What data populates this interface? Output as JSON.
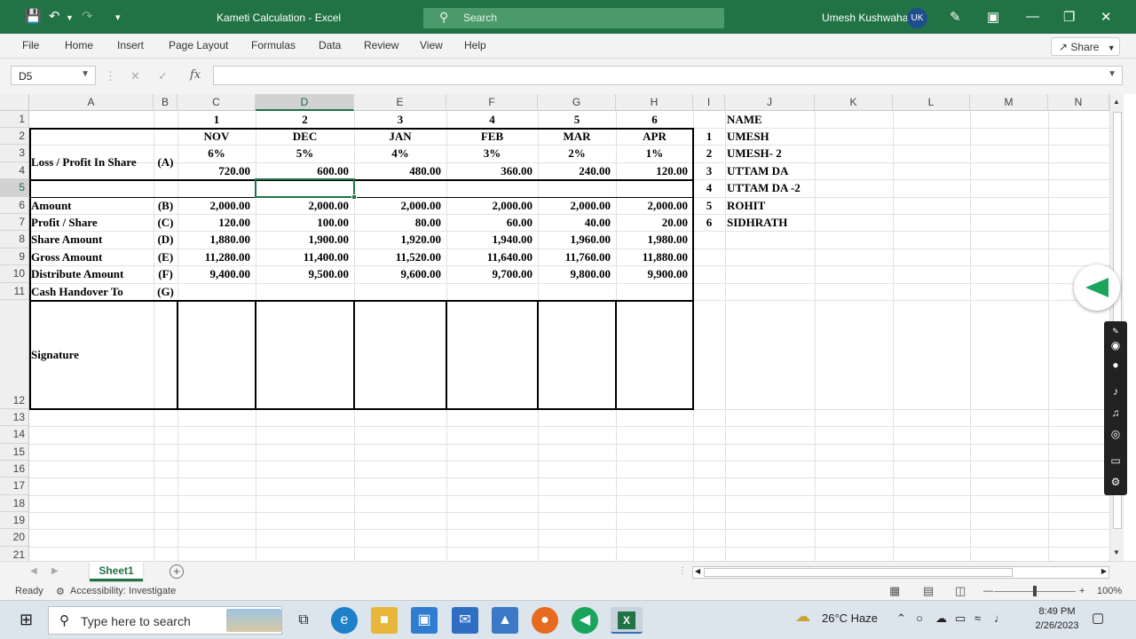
{
  "titlebar": {
    "title": "Kameti Calculation  -  Excel",
    "search_placeholder": "Search",
    "user_name": "Umesh Kushwaha",
    "user_initials": "UK"
  },
  "ribbon": {
    "tabs": [
      "File",
      "Home",
      "Insert",
      "Page Layout",
      "Formulas",
      "Data",
      "Review",
      "View",
      "Help"
    ],
    "share_label": "Share"
  },
  "formula_bar": {
    "name_box": "D5",
    "fx_label": "fx",
    "formula": ""
  },
  "columns": [
    "A",
    "B",
    "C",
    "D",
    "E",
    "F",
    "G",
    "H",
    "I",
    "J",
    "K",
    "L",
    "M",
    "N"
  ],
  "rows": [
    "1",
    "2",
    "3",
    "4",
    "5",
    "6",
    "7",
    "8",
    "9",
    "10",
    "11",
    "12",
    "13",
    "14",
    "15",
    "16",
    "17",
    "18",
    "19",
    "20",
    "21"
  ],
  "selected_cell": {
    "column": "D",
    "row": "5"
  },
  "sheet": {
    "serials": [
      "1",
      "2",
      "3",
      "4",
      "5",
      "6"
    ],
    "months": [
      "NOV",
      "DEC",
      "JAN",
      "FEB",
      "MAR",
      "APR"
    ],
    "percentages": [
      "6%",
      "5%",
      "4%",
      "3%",
      "2%",
      "1%"
    ],
    "loss_profit_label": "Loss / Profit In Share",
    "loss_profit_code": "(A)",
    "loss_profit_values": [
      "720.00",
      "600.00",
      "480.00",
      "360.00",
      "240.00",
      "120.00"
    ],
    "rows": [
      {
        "label": "Amount",
        "code": "(B)",
        "values": [
          "2,000.00",
          "2,000.00",
          "2,000.00",
          "2,000.00",
          "2,000.00",
          "2,000.00"
        ]
      },
      {
        "label": "Profit / Share",
        "code": "(C)",
        "values": [
          "120.00",
          "100.00",
          "80.00",
          "60.00",
          "40.00",
          "20.00"
        ]
      },
      {
        "label": "Share Amount",
        "code": "(D)",
        "values": [
          "1,880.00",
          "1,900.00",
          "1,920.00",
          "1,940.00",
          "1,960.00",
          "1,980.00"
        ]
      },
      {
        "label": "Gross Amount",
        "code": "(E)",
        "values": [
          "11,280.00",
          "11,400.00",
          "11,520.00",
          "11,640.00",
          "11,760.00",
          "11,880.00"
        ]
      },
      {
        "label": "Distribute Amount",
        "code": "(F)",
        "values": [
          "9,400.00",
          "9,500.00",
          "9,600.00",
          "9,700.00",
          "9,800.00",
          "9,900.00"
        ]
      },
      {
        "label": "Cash Handover To",
        "code": "(G)",
        "values": [
          "",
          "",
          "",
          "",
          "",
          ""
        ]
      }
    ],
    "signature_label": "Signature",
    "name_header": "NAME",
    "names": [
      {
        "no": "1",
        "name": "UMESH"
      },
      {
        "no": "2",
        "name": "UMESH- 2"
      },
      {
        "no": "3",
        "name": "UTTAM DA"
      },
      {
        "no": "4",
        "name": "UTTAM DA -2"
      },
      {
        "no": "5",
        "name": "ROHIT"
      },
      {
        "no": "6",
        "name": "SIDHRATH"
      }
    ]
  },
  "sheet_tabs": {
    "active": "Sheet1"
  },
  "statusbar": {
    "ready": "Ready",
    "accessibility": "Accessibility: Investigate",
    "zoom": "100%"
  },
  "taskbar": {
    "search_placeholder": "Type here to search",
    "weather": "26°C  Haze",
    "time": "8:49 PM",
    "date": "2/26/2023"
  }
}
